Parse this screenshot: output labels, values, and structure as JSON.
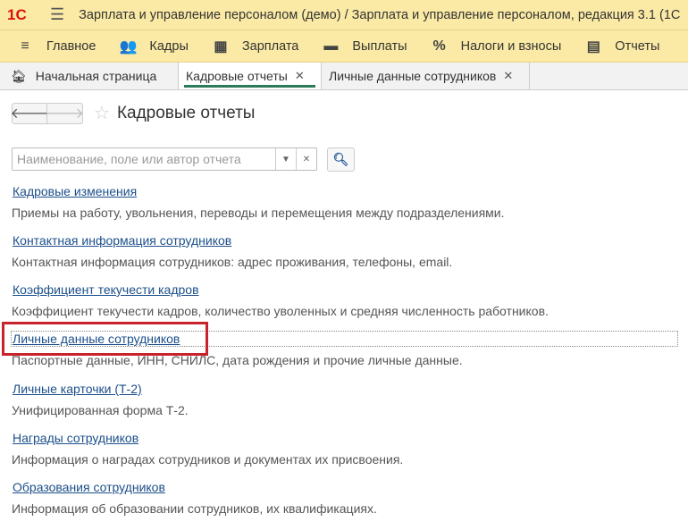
{
  "app": {
    "logo": "1С",
    "title": "Зарплата и управление персоналом (демо) / Зарплата и управление персоналом, редакция 3.1  (1С"
  },
  "nav": [
    {
      "label": "Главное",
      "icon": "menu-icon"
    },
    {
      "label": "Кадры",
      "icon": "people-icon"
    },
    {
      "label": "Зарплата",
      "icon": "calculator-icon"
    },
    {
      "label": "Выплаты",
      "icon": "wallet-icon"
    },
    {
      "label": "Налоги и взносы",
      "icon": "percent-icon"
    },
    {
      "label": "Отчеты",
      "icon": "reports-icon"
    }
  ],
  "tabs": [
    {
      "label": "Начальная страница"
    },
    {
      "label": "Кадровые отчеты"
    },
    {
      "label": "Личные данные сотрудников"
    }
  ],
  "page": {
    "title": "Кадровые отчеты",
    "search_placeholder": "Наименование, поле или автор отчета"
  },
  "reports": [
    {
      "name": "Кадровые изменения",
      "desc": "Приемы на работу, увольнения, переводы и перемещения между подразделениями."
    },
    {
      "name": "Контактная информация сотрудников",
      "desc": "Контактная информация сотрудников: адрес проживания, телефоны, email."
    },
    {
      "name": "Коэффициент текучести кадров",
      "desc": "Коэффициент текучести кадров, количество уволенных и средняя численность работников."
    },
    {
      "name": "Личные данные сотрудников",
      "desc": "Паспортные данные, ИНН, СНИЛС, дата рождения и прочие личные данные."
    },
    {
      "name": "Личные карточки (Т-2)",
      "desc": "Унифицированная форма Т-2."
    },
    {
      "name": "Награды сотрудников",
      "desc": "Информация о наградах сотрудников и документах их присвоения."
    },
    {
      "name": "Образования сотрудников",
      "desc": "Информация об образовании сотрудников, их квалификациях."
    }
  ]
}
